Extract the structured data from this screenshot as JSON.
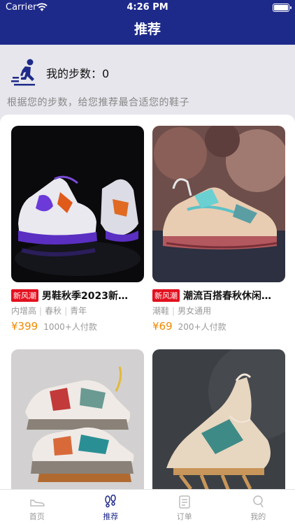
{
  "status_bar": {
    "carrier": "Carrier",
    "time": "4:26 PM"
  },
  "nav": {
    "title": "推荐"
  },
  "steps": {
    "label": "我的步数：0"
  },
  "subtitle": "根据您的步数，给您推荐最合适您的鞋子",
  "products": [
    {
      "badge": "新风潮",
      "title": "男鞋秋季2023新…",
      "tags": [
        "内增高",
        "春秋",
        "青年"
      ],
      "price": "¥399",
      "sold": "1000+人付款"
    },
    {
      "badge": "新风潮",
      "title": "潮流百搭春秋休闲…",
      "tags": [
        "潮鞋",
        "男女通用"
      ],
      "price": "¥69",
      "sold": "200+人付款"
    },
    {
      "badge": "",
      "title": "",
      "tags": [],
      "price": "",
      "sold": ""
    },
    {
      "badge": "",
      "title": "",
      "tags": [],
      "price": "",
      "sold": ""
    }
  ],
  "tabs": [
    {
      "label": "首页",
      "icon": "shoe-icon",
      "active": false
    },
    {
      "label": "推荐",
      "icon": "footprints-icon",
      "active": true
    },
    {
      "label": "订单",
      "icon": "clipboard-icon",
      "active": false
    },
    {
      "label": "我的",
      "icon": "person-icon",
      "active": false
    }
  ],
  "colors": {
    "brand": "#1e2a8a",
    "badge": "#e3101e",
    "price": "#f08a00"
  }
}
